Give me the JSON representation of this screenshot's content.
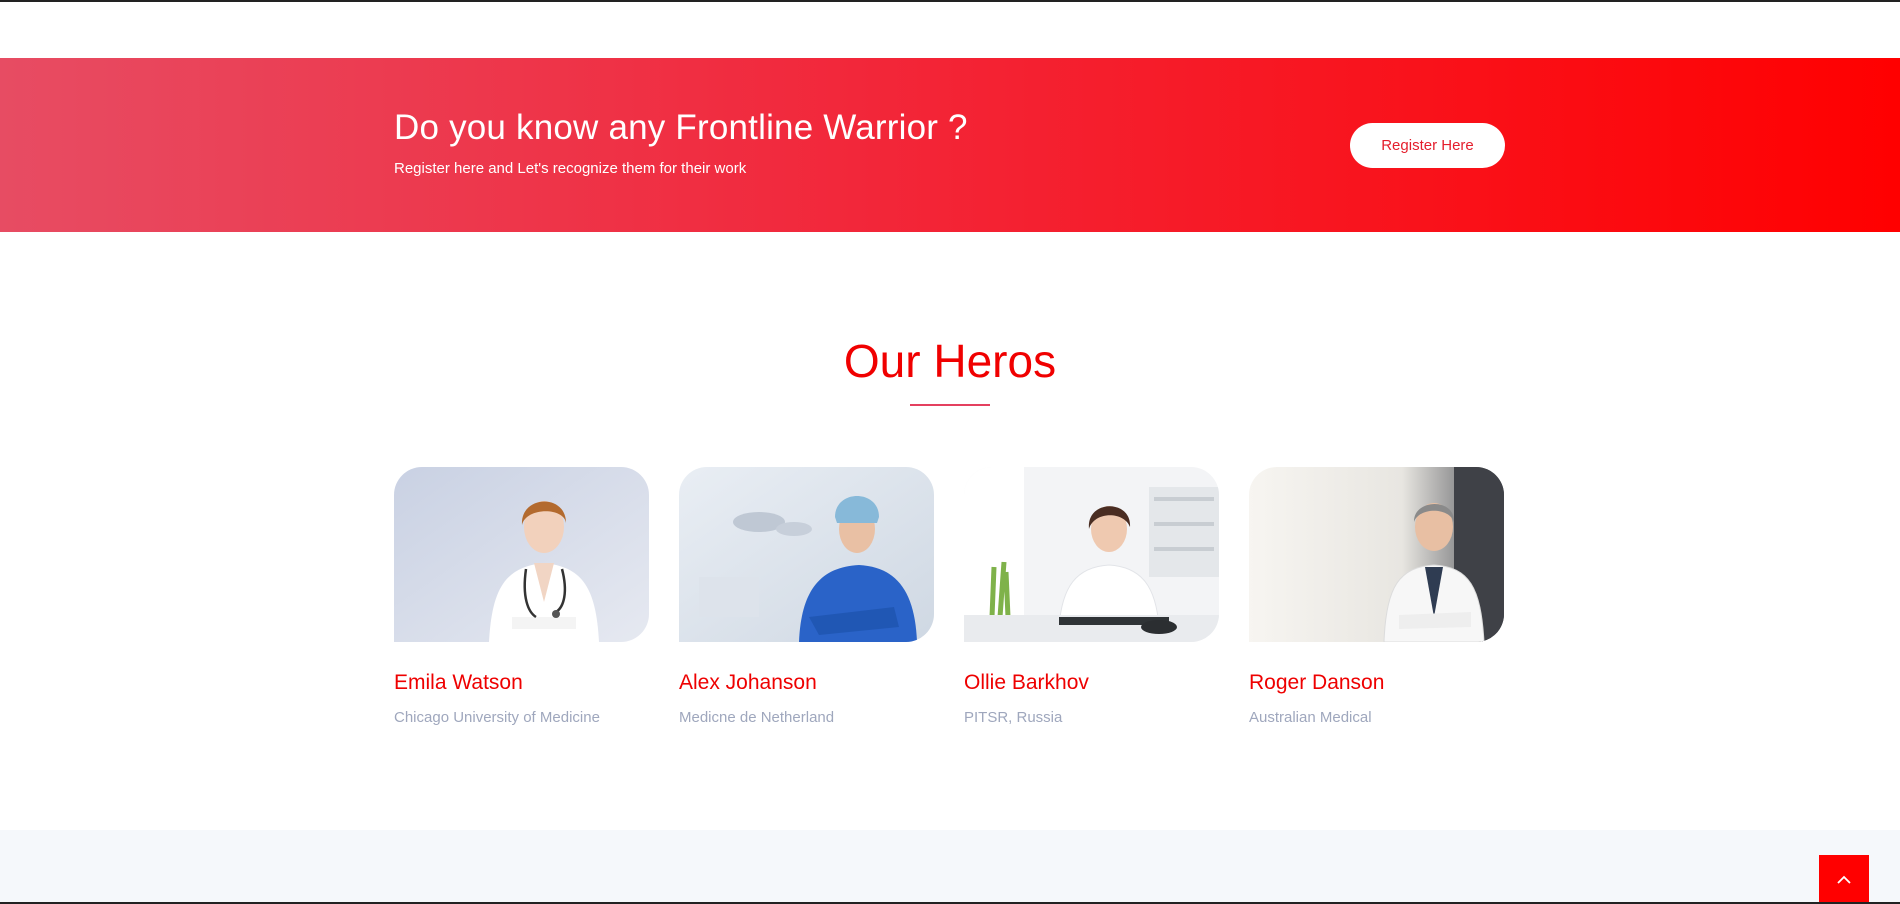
{
  "cta": {
    "title": "Do you know any Frontline Warrior ?",
    "subtitle": "Register here and Let's recognize them for their work",
    "button_label": "Register Here"
  },
  "heroes": {
    "title": "Our Heros",
    "items": [
      {
        "name": "Emila Watson",
        "org": "Chicago University of Medicine"
      },
      {
        "name": "Alex Johanson",
        "org": "Medicne de Netherland"
      },
      {
        "name": "Ollie Barkhov",
        "org": "PITSR, Russia"
      },
      {
        "name": "Roger Danson",
        "org": "Australian Medical"
      }
    ]
  },
  "icons": {
    "back_to_top": "chevron-up-icon"
  },
  "colors": {
    "accent": "#ff0000",
    "accent_text": "#ee0000",
    "muted_text": "#9fa7bd",
    "gradient_start": "#e74c63",
    "gradient_end": "#ff0000"
  }
}
